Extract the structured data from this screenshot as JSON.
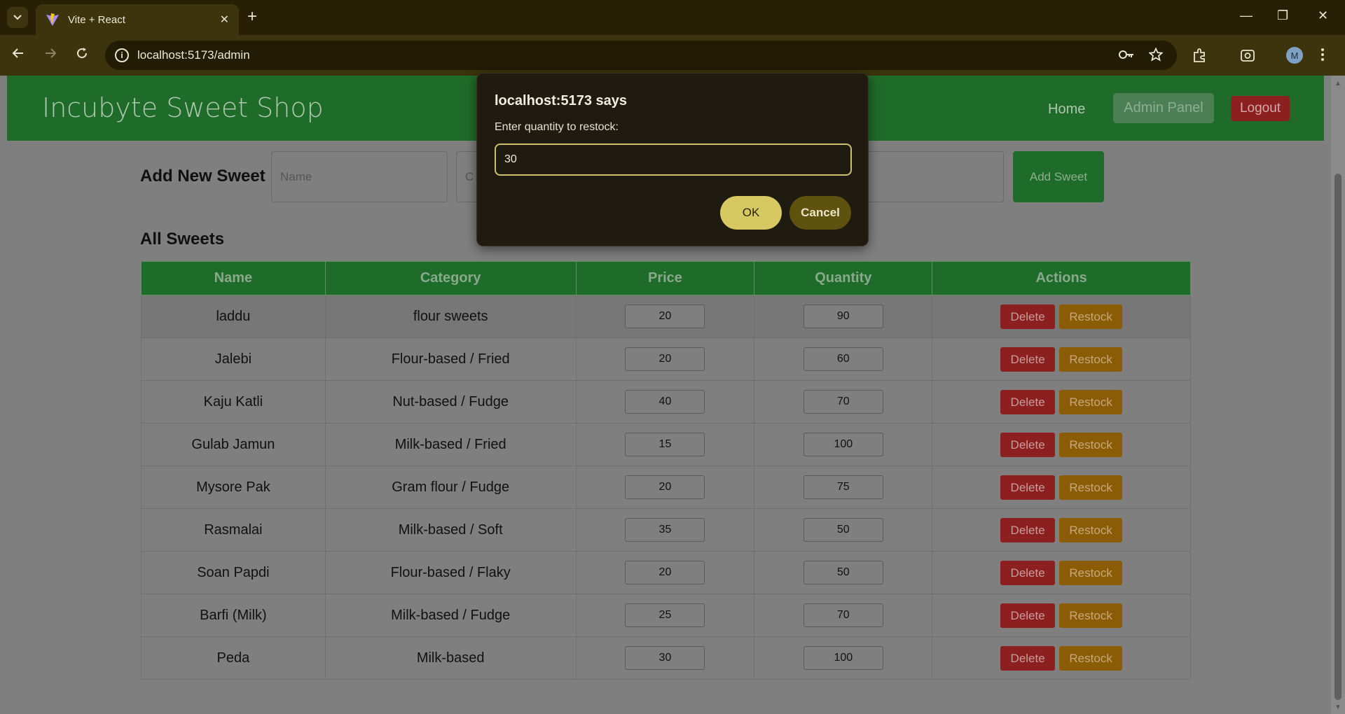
{
  "browser": {
    "tab_title": "Vite + React",
    "tab_list_icon": "chevron-down-icon",
    "new_tab_symbol": "+",
    "url": "localhost:5173/admin",
    "window_controls": {
      "minimize": "—",
      "restore": "❐",
      "close": "✕"
    }
  },
  "header": {
    "brand": "Incubyte Sweet Shop",
    "nav": {
      "home": "Home",
      "admin": "Admin Panel",
      "logout": "Logout"
    }
  },
  "add_form": {
    "title": "Add New Sweet",
    "name_placeholder": "Name",
    "category_placeholder": "C",
    "quantity_placeholder": "ity",
    "submit": "Add Sweet"
  },
  "list": {
    "title": "All Sweets",
    "columns": [
      "Name",
      "Category",
      "Price",
      "Quantity",
      "Actions"
    ],
    "delete_label": "Delete",
    "restock_label": "Restock",
    "rows": [
      {
        "name": "laddu",
        "category": "flour sweets",
        "price": "20",
        "quantity": "90"
      },
      {
        "name": "Jalebi",
        "category": "Flour-based / Fried",
        "price": "20",
        "quantity": "60"
      },
      {
        "name": "Kaju Katli",
        "category": "Nut-based / Fudge",
        "price": "40",
        "quantity": "70"
      },
      {
        "name": "Gulab Jamun",
        "category": "Milk-based / Fried",
        "price": "15",
        "quantity": "100"
      },
      {
        "name": "Mysore Pak",
        "category": "Gram flour / Fudge",
        "price": "20",
        "quantity": "75"
      },
      {
        "name": "Rasmalai",
        "category": "Milk-based / Soft",
        "price": "35",
        "quantity": "50"
      },
      {
        "name": "Soan Papdi",
        "category": "Flour-based / Flaky",
        "price": "20",
        "quantity": "50"
      },
      {
        "name": "Barfi (Milk)",
        "category": "Milk-based / Fudge",
        "price": "25",
        "quantity": "70"
      },
      {
        "name": "Peda",
        "category": "Milk-based",
        "price": "30",
        "quantity": "100"
      }
    ]
  },
  "dialog": {
    "title": "localhost:5173 says",
    "message": "Enter quantity to restock:",
    "value": "30",
    "ok": "OK",
    "cancel": "Cancel"
  },
  "colors": {
    "header_bg": "#1f6b29",
    "delete_bg": "#8c2020",
    "restock_bg": "#8a5c06",
    "dialog_bg": "#1f1b10",
    "ok_bg": "#d7c962"
  }
}
